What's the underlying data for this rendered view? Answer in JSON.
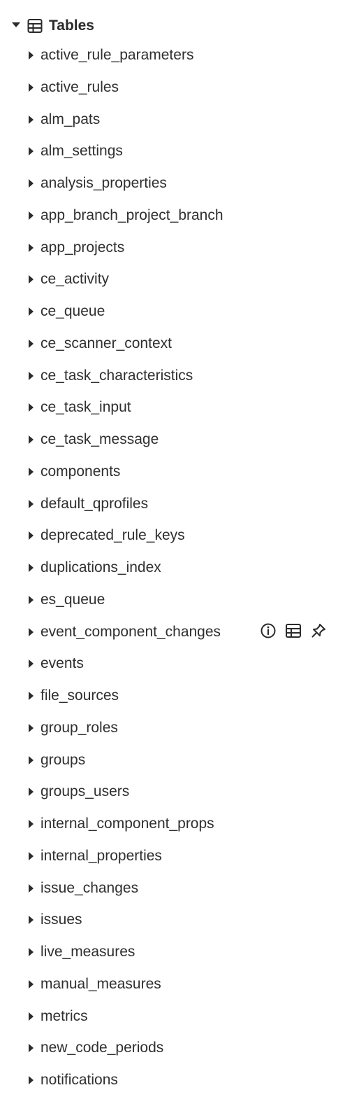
{
  "tree": {
    "root": {
      "label": "Tables",
      "expanded": true,
      "icon": "table-icon"
    },
    "items": [
      {
        "label": "active_rule_parameters"
      },
      {
        "label": "active_rules"
      },
      {
        "label": "alm_pats"
      },
      {
        "label": "alm_settings"
      },
      {
        "label": "analysis_properties"
      },
      {
        "label": "app_branch_project_branch"
      },
      {
        "label": "app_projects"
      },
      {
        "label": "ce_activity"
      },
      {
        "label": "ce_queue"
      },
      {
        "label": "ce_scanner_context"
      },
      {
        "label": "ce_task_characteristics"
      },
      {
        "label": "ce_task_input"
      },
      {
        "label": "ce_task_message"
      },
      {
        "label": "components"
      },
      {
        "label": "default_qprofiles"
      },
      {
        "label": "deprecated_rule_keys"
      },
      {
        "label": "duplications_index"
      },
      {
        "label": "es_queue"
      },
      {
        "label": "event_component_changes",
        "hovered": true,
        "actions": [
          "info-icon",
          "table-icon",
          "pin-icon"
        ]
      },
      {
        "label": "events"
      },
      {
        "label": "file_sources"
      },
      {
        "label": "group_roles"
      },
      {
        "label": "groups"
      },
      {
        "label": "groups_users"
      },
      {
        "label": "internal_component_props"
      },
      {
        "label": "internal_properties"
      },
      {
        "label": "issue_changes"
      },
      {
        "label": "issues"
      },
      {
        "label": "live_measures"
      },
      {
        "label": "manual_measures"
      },
      {
        "label": "metrics"
      },
      {
        "label": "new_code_periods"
      },
      {
        "label": "notifications"
      }
    ]
  },
  "colors": {
    "text": "#2f2f2f",
    "icon": "#2b2b2b",
    "background": "#ffffff"
  }
}
